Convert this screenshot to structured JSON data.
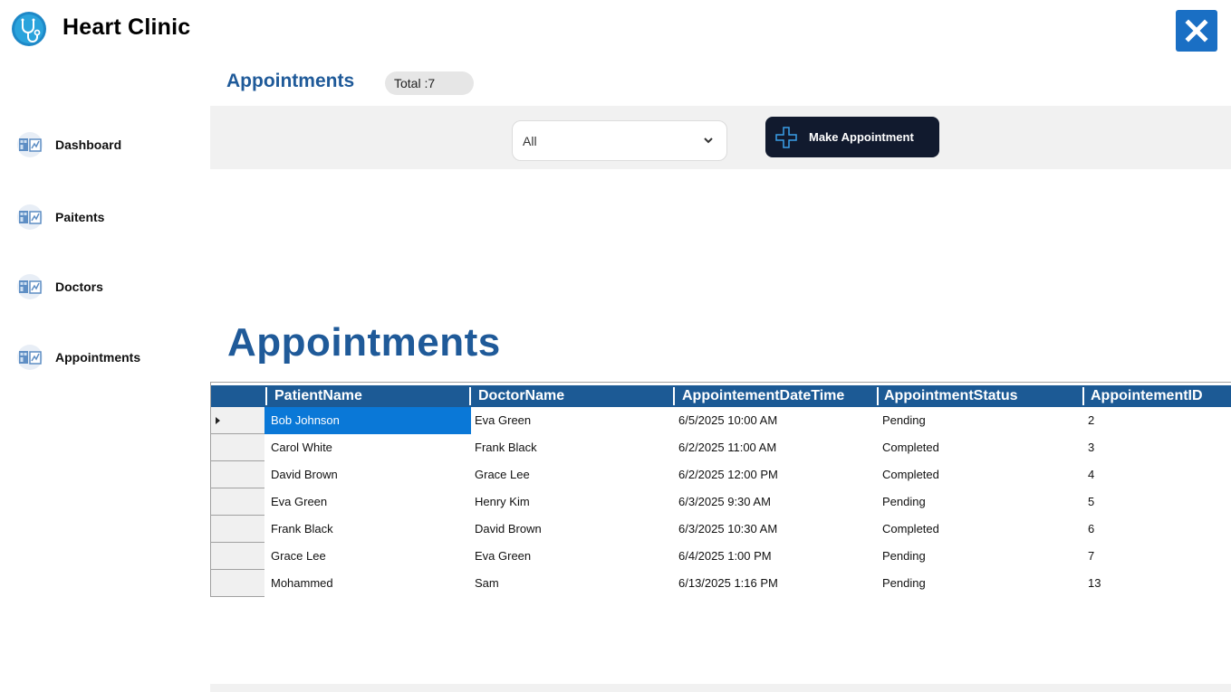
{
  "app": {
    "title": "Heart Clinic"
  },
  "sidebar": {
    "items": [
      {
        "label": "Dashboard"
      },
      {
        "label": "Paitents"
      },
      {
        "label": "Doctors"
      },
      {
        "label": "Appointments"
      }
    ]
  },
  "header": {
    "title": "Appointments",
    "total_label": "Total :7"
  },
  "toolbar": {
    "filter_value": "All",
    "make_button_label": "Make Appointment"
  },
  "section_heading": "Appointments",
  "grid": {
    "columns": [
      "PatientName",
      "DoctorName",
      "AppointementDateTime",
      "AppointmentStatus",
      "AppointementID"
    ],
    "rows": [
      [
        "Bob Johnson",
        "Eva Green",
        "6/5/2025 10:00 AM",
        "Pending",
        "2"
      ],
      [
        "Carol White",
        "Frank Black",
        "6/2/2025 11:00 AM",
        "Completed",
        "3"
      ],
      [
        "David Brown",
        "Grace Lee",
        "6/2/2025 12:00 PM",
        "Completed",
        "4"
      ],
      [
        "Eva Green",
        "Henry Kim",
        "6/3/2025 9:30 AM",
        "Pending",
        "5"
      ],
      [
        "Frank Black",
        "David Brown",
        "6/3/2025 10:30 AM",
        "Completed",
        "6"
      ],
      [
        "Grace Lee",
        "Eva Green",
        "6/4/2025 1:00 PM",
        "Pending",
        "7"
      ],
      [
        "Mohammed",
        "Sam",
        "6/13/2025 1:16 PM",
        "Pending",
        "13"
      ]
    ]
  },
  "colors": {
    "brand_blue": "#1f5a99",
    "grid_header": "#1c5a95",
    "selection": "#0a78d7",
    "close_button": "#1a6fc4",
    "primary_button": "#111a2e"
  },
  "icons": {
    "logo": "stethoscope-icon",
    "close": "close-icon",
    "nav": "report-icon",
    "filter": "chevron-down-icon",
    "make": "plus-icon",
    "row_pointer": "row-pointer-icon"
  }
}
